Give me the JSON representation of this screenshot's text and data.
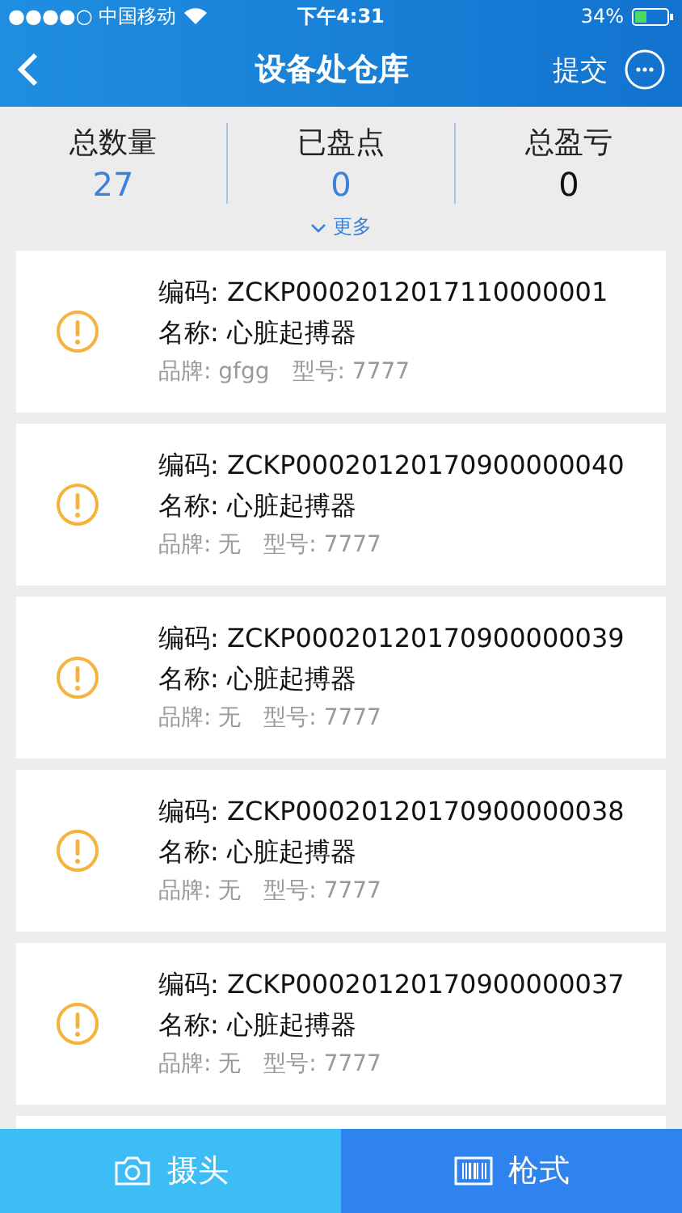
{
  "status_bar": {
    "carrier": "●●●●○ 中国移动",
    "time": "下午4:31",
    "battery": "34%"
  },
  "nav": {
    "title": "设备处仓库",
    "action": "提交"
  },
  "stats": [
    {
      "label": "总数量",
      "value": "27",
      "color": "#3a82dc"
    },
    {
      "label": "已盘点",
      "value": "0",
      "color": "#3a82dc"
    },
    {
      "label": "总盈亏",
      "value": "0",
      "color": "#111111"
    }
  ],
  "more": "更多",
  "items": [
    {
      "code": "编码: ZCKP0002012017110000001",
      "name": "名称: 心脏起搏器",
      "brand": "品牌: gfgg",
      "model": "型号: 7777"
    },
    {
      "code": "编码: ZCKP00020120170900000040",
      "name": "名称: 心脏起搏器",
      "brand": "品牌: 无",
      "model": "型号: 7777"
    },
    {
      "code": "编码: ZCKP00020120170900000039",
      "name": "名称: 心脏起搏器",
      "brand": "品牌: 无",
      "model": "型号: 7777"
    },
    {
      "code": "编码: ZCKP00020120170900000038",
      "name": "名称: 心脏起搏器",
      "brand": "品牌: 无",
      "model": "型号: 7777"
    },
    {
      "code": "编码: ZCKP00020120170900000037",
      "name": "名称: 心脏起搏器",
      "brand": "品牌: 无",
      "model": "型号: 7777"
    }
  ],
  "bottom_buttons": [
    {
      "kind": "camera",
      "label": "摄头"
    },
    {
      "kind": "barcode",
      "label": "枪式"
    }
  ]
}
